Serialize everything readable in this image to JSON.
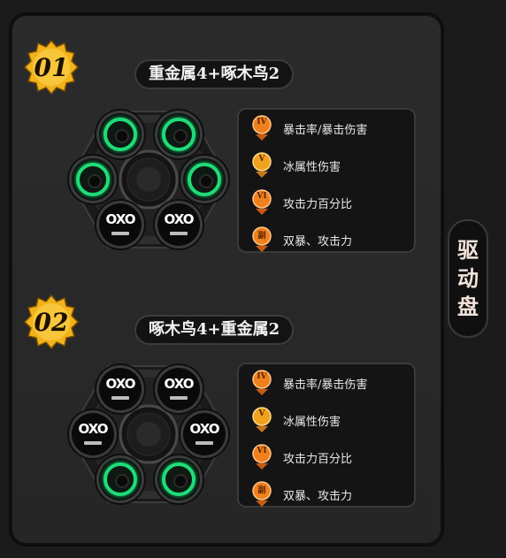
{
  "side_tab": {
    "label_chars": [
      "驱",
      "动",
      "盘"
    ]
  },
  "colors": {
    "accent_green": "#1fdc78",
    "badge_gold": "#f2b21b",
    "stat_orange": "#f0801e"
  },
  "sets": [
    {
      "badge": "01",
      "title": "重金属4+啄木鸟2",
      "slots": [
        {
          "type": "ring",
          "icon": "green-ring-icon"
        },
        {
          "type": "ring",
          "icon": "green-ring-icon"
        },
        {
          "type": "ring",
          "icon": "green-ring-icon"
        },
        {
          "type": "ring",
          "icon": "green-ring-icon"
        },
        {
          "type": "oxo",
          "mark": "OXO",
          "icon": "oxo-logo-icon"
        },
        {
          "type": "oxo",
          "mark": "OXO",
          "icon": "oxo-logo-icon"
        }
      ],
      "stats": [
        {
          "roman": "IV",
          "label": "暴击率/暴击伤害"
        },
        {
          "roman": "V",
          "label": "冰属性伤害"
        },
        {
          "roman": "VI",
          "label": "攻击力百分比"
        },
        {
          "roman": "副",
          "label": "双暴、攻击力"
        }
      ]
    },
    {
      "badge": "02",
      "title": "啄木鸟4+重金属2",
      "slots": [
        {
          "type": "oxo",
          "mark": "OXO",
          "icon": "oxo-logo-icon"
        },
        {
          "type": "oxo",
          "mark": "OXO",
          "icon": "oxo-logo-icon"
        },
        {
          "type": "oxo",
          "mark": "OXO",
          "icon": "oxo-logo-icon"
        },
        {
          "type": "oxo",
          "mark": "OXO",
          "icon": "oxo-logo-icon"
        },
        {
          "type": "ring",
          "icon": "green-ring-icon"
        },
        {
          "type": "ring",
          "icon": "green-ring-icon"
        }
      ],
      "stats": [
        {
          "roman": "IV",
          "label": "暴击率/暴击伤害"
        },
        {
          "roman": "V",
          "label": "冰属性伤害"
        },
        {
          "roman": "VI",
          "label": "攻击力百分比"
        },
        {
          "roman": "副",
          "label": "双暴、攻击力"
        }
      ]
    }
  ]
}
